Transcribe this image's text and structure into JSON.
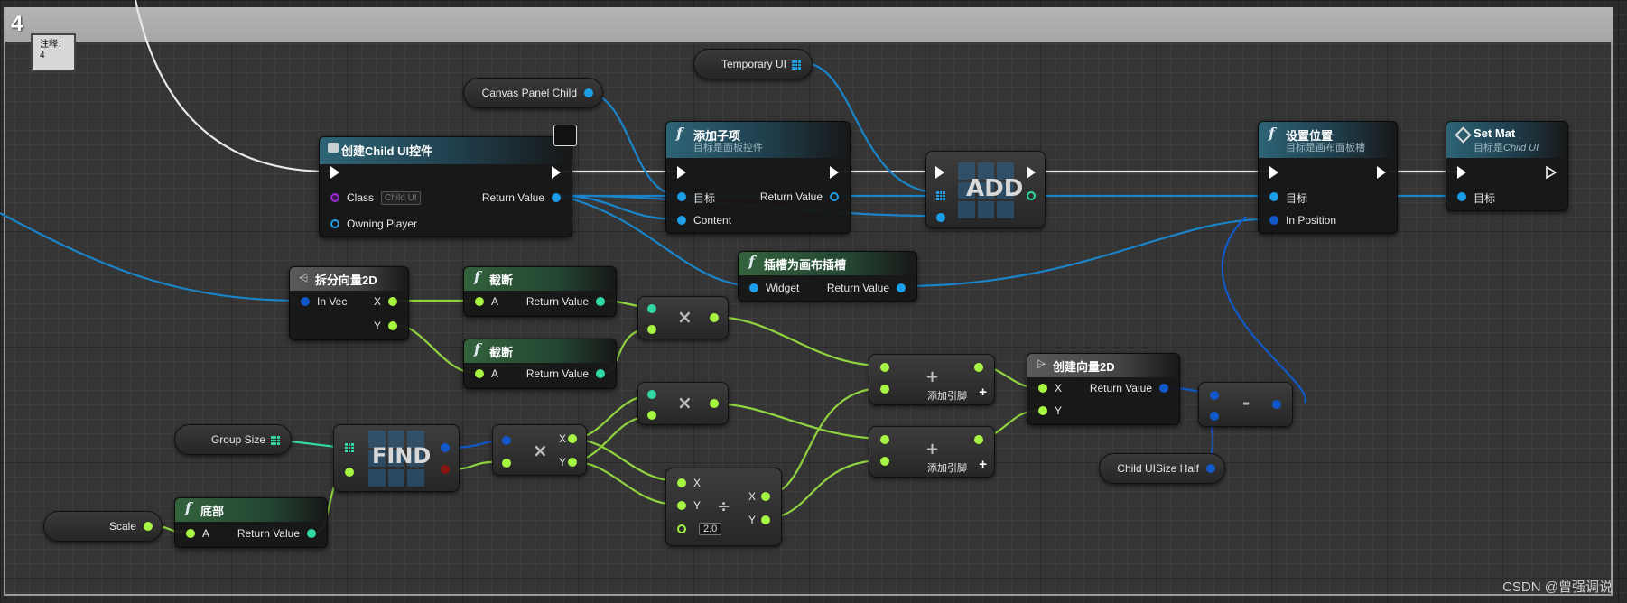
{
  "comment": {
    "number": "4",
    "bubble": "注释：\n4"
  },
  "nodes": {
    "create_widget": {
      "title": "创建Child UI控件",
      "class_label": "Class",
      "class_value": "Child UI",
      "owning_player": "Owning Player",
      "return_value": "Return Value"
    },
    "add_child": {
      "title": "添加子项",
      "subtitle": "目标是面板控件",
      "target": "目标",
      "content": "Content",
      "return_value": "Return Value"
    },
    "add_array": {
      "label": "ADD"
    },
    "set_position": {
      "title": "设置位置",
      "subtitle": "目标是画布面板槽",
      "target": "目标",
      "in_position": "In Position"
    },
    "set_mat": {
      "title": "Set Mat",
      "subtitle_prefix": "目标是",
      "subtitle_italic": "Child UI",
      "target": "目标"
    },
    "slot_as_canvas": {
      "title": "插槽为画布插槽",
      "widget": "Widget",
      "return_value": "Return Value"
    },
    "break_vec": {
      "title": "拆分向量2D",
      "in_vec": "In Vec",
      "x": "X",
      "y": "Y"
    },
    "trunc1": {
      "title": "截断",
      "a": "A",
      "return_value": "Return Value"
    },
    "trunc2": {
      "title": "截断",
      "a": "A",
      "return_value": "Return Value"
    },
    "floor": {
      "title": "底部",
      "a": "A",
      "return_value": "Return Value"
    },
    "find": {
      "label": "FIND"
    },
    "make_vec": {
      "title": "创建向量2D",
      "x": "X",
      "y": "Y",
      "return_value": "Return Value"
    },
    "divide": {
      "x_in": "X",
      "y_in": "Y",
      "x_out": "X",
      "y_out": "Y",
      "divisor": "2.0"
    },
    "add1": {
      "add_pin": "添加引脚"
    },
    "add2": {
      "add_pin": "添加引脚"
    },
    "multiply_vec": {
      "x": "X",
      "y": "Y"
    }
  },
  "variables": {
    "canvas_panel_child": "Canvas Panel Child",
    "temporary_ui": "Temporary UI",
    "group_size": "Group Size",
    "scale": "Scale",
    "child_ui_size_half": "Child UISize Half"
  },
  "watermark": "CSDN @曾强调说",
  "colors": {
    "exec": "#ffffff",
    "object": "#1d9ee8",
    "float": "#a6f543",
    "int": "#32d7a6",
    "vector2d": "#1158c8",
    "class": "#9b2bd6",
    "comment_header": "#b4b4b4"
  }
}
